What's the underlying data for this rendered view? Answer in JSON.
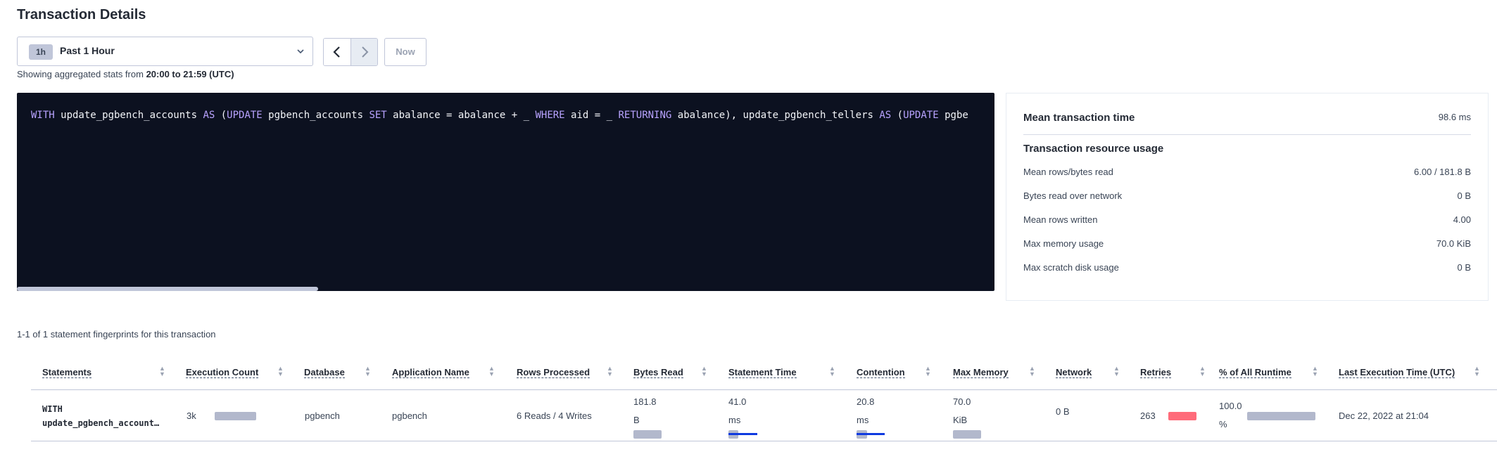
{
  "page": {
    "title": "Transaction Details"
  },
  "time_range": {
    "badge": "1h",
    "label": "Past 1 Hour",
    "caret_icon": "chevron-down-icon",
    "prev_icon": "chevron-left-icon",
    "next_icon": "chevron-right-icon",
    "now_label": "Now",
    "note_prefix": "Showing aggregated stats from ",
    "note_range": "20:00 to 21:59 (UTC)"
  },
  "sql": {
    "tokens": [
      {
        "t": "WITH",
        "kw": true
      },
      {
        "t": " update_pgbench_accounts ",
        "kw": false
      },
      {
        "t": "AS",
        "kw": true
      },
      {
        "t": " (",
        "kw": false
      },
      {
        "t": "UPDATE",
        "kw": true
      },
      {
        "t": " pgbench_accounts ",
        "kw": false
      },
      {
        "t": "SET",
        "kw": true
      },
      {
        "t": " abalance = abalance + _ ",
        "kw": false
      },
      {
        "t": "WHERE",
        "kw": true
      },
      {
        "t": " aid = _ ",
        "kw": false
      },
      {
        "t": "RETURNING",
        "kw": true
      },
      {
        "t": " abalance), update_pgbench_tellers ",
        "kw": false
      },
      {
        "t": "AS",
        "kw": true
      },
      {
        "t": " (",
        "kw": false
      },
      {
        "t": "UPDATE",
        "kw": true
      },
      {
        "t": " pgbe",
        "kw": false
      }
    ]
  },
  "summary": {
    "mean_time_label": "Mean transaction time",
    "mean_time_value": "98.6 ms",
    "resource_heading": "Transaction resource usage",
    "rows": [
      {
        "label": "Mean rows/bytes read",
        "value": "6.00 / 181.8 B"
      },
      {
        "label": "Bytes read over network",
        "value": "0 B"
      },
      {
        "label": "Mean rows written",
        "value": "4.00"
      },
      {
        "label": "Max memory usage",
        "value": "70.0 KiB"
      },
      {
        "label": "Max scratch disk usage",
        "value": "0 B"
      }
    ]
  },
  "table": {
    "count_note": "1-1 of 1 statement fingerprints for this transaction",
    "columns": [
      "Statements",
      "Execution Count",
      "Database",
      "Application Name",
      "Rows Processed",
      "Bytes Read",
      "Statement Time",
      "Contention",
      "Max Memory",
      "Network",
      "Retries",
      "% of All Runtime",
      "Last Execution Time (UTC)"
    ],
    "row": {
      "statement_line1": "WITH",
      "statement_line2": "update_pgbench_account…",
      "execution_count": "3k",
      "database": "pgbench",
      "application_name": "pgbench",
      "rows_processed": "6 Reads / 4 Writes",
      "bytes_read_value": "181.8",
      "bytes_read_unit": "B",
      "statement_time_value": "41.0",
      "statement_time_unit": "ms",
      "contention_value": "20.8",
      "contention_unit": "ms",
      "max_memory_value": "70.0",
      "max_memory_unit": "KiB",
      "network": "0 B",
      "retries": "263",
      "runtime_value": "100.0",
      "runtime_unit": "%",
      "last_execution": "Dec 22, 2022 at 21:04"
    }
  },
  "colors": {
    "sql_bg": "#0c1120",
    "keyword": "#b8a3ff",
    "bar": "#b2b8cc",
    "retry_bar": "#ff6b7a",
    "deviation": "#0f3ae0"
  }
}
